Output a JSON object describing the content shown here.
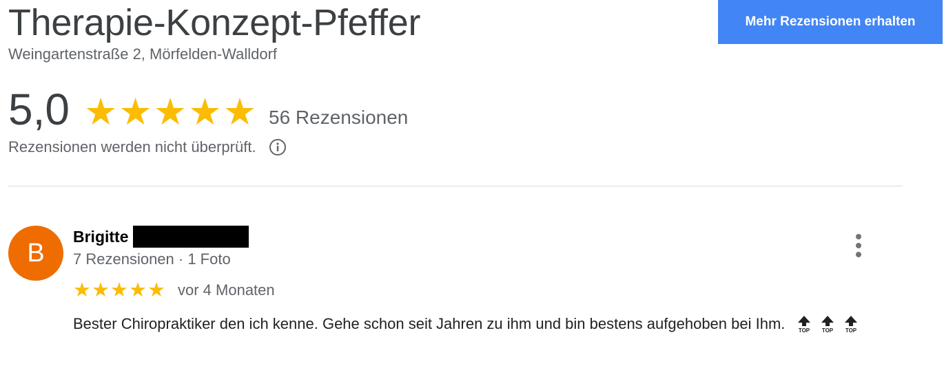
{
  "place": {
    "name": "Therapie-Konzept-Pfeffer",
    "address": "Weingartenstraße 2, Mörfelden-Walldorf"
  },
  "cta": {
    "label": "Mehr Rezensionen erhalten",
    "color": "#4285f4"
  },
  "rating": {
    "value": "5,0",
    "stars": 5,
    "max_stars": 5,
    "review_count_label": "56 Rezensionen",
    "star_color": "#fbbc04",
    "disclaimer": "Rezensionen werden nicht überprüft.",
    "info_icon": "info-circle-icon"
  },
  "reviews": [
    {
      "author_initial": "B",
      "author_name": "Brigitte",
      "author_surname_redacted": true,
      "avatar_color": "#ef6c00",
      "meta": "7 Rezensionen · 1 Foto",
      "stars": 5,
      "date": "vor 4 Monaten",
      "text": "Bester Chiropraktiker den ich kenne. Gehe schon seit Jahren zu ihm und bin bestens aufgehoben bei Ihm.",
      "emojis": [
        "TOP",
        "TOP",
        "TOP"
      ],
      "more_icon": "more-vert-icon"
    }
  ]
}
